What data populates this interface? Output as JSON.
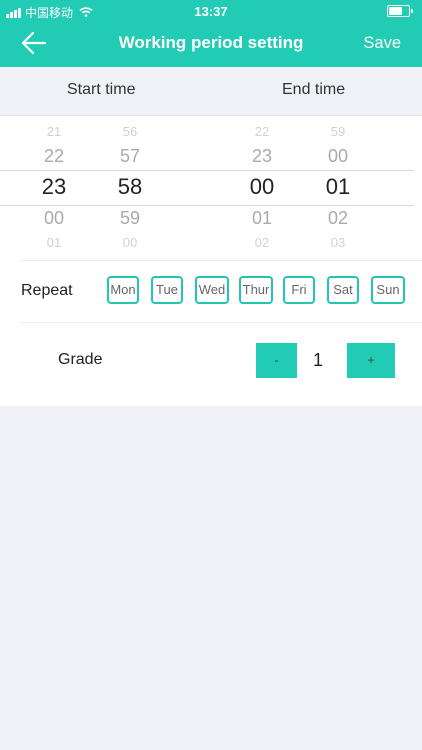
{
  "status_bar": {
    "carrier": "中国移动",
    "time": "13:37"
  },
  "nav": {
    "title": "Working period setting",
    "save_label": "Save"
  },
  "time_labels": {
    "start": "Start time",
    "end": "End time"
  },
  "pickers": {
    "start_hour": [
      "21",
      "22",
      "23",
      "00",
      "01"
    ],
    "start_minute": [
      "56",
      "57",
      "58",
      "59",
      "00"
    ],
    "end_hour": [
      "22",
      "23",
      "00",
      "01",
      "02"
    ],
    "end_minute": [
      "59",
      "00",
      "01",
      "02",
      "03"
    ]
  },
  "repeat": {
    "label": "Repeat",
    "days": [
      "Mon",
      "Tue",
      "Wed",
      "Thur",
      "Fri",
      "Sat",
      "Sun"
    ]
  },
  "grade": {
    "label": "Grade",
    "minus": "-",
    "value": "1",
    "plus": "+"
  },
  "colors": {
    "accent": "#22ccb4",
    "day_border": "#22c6b0",
    "background": "#f0f0f7"
  }
}
